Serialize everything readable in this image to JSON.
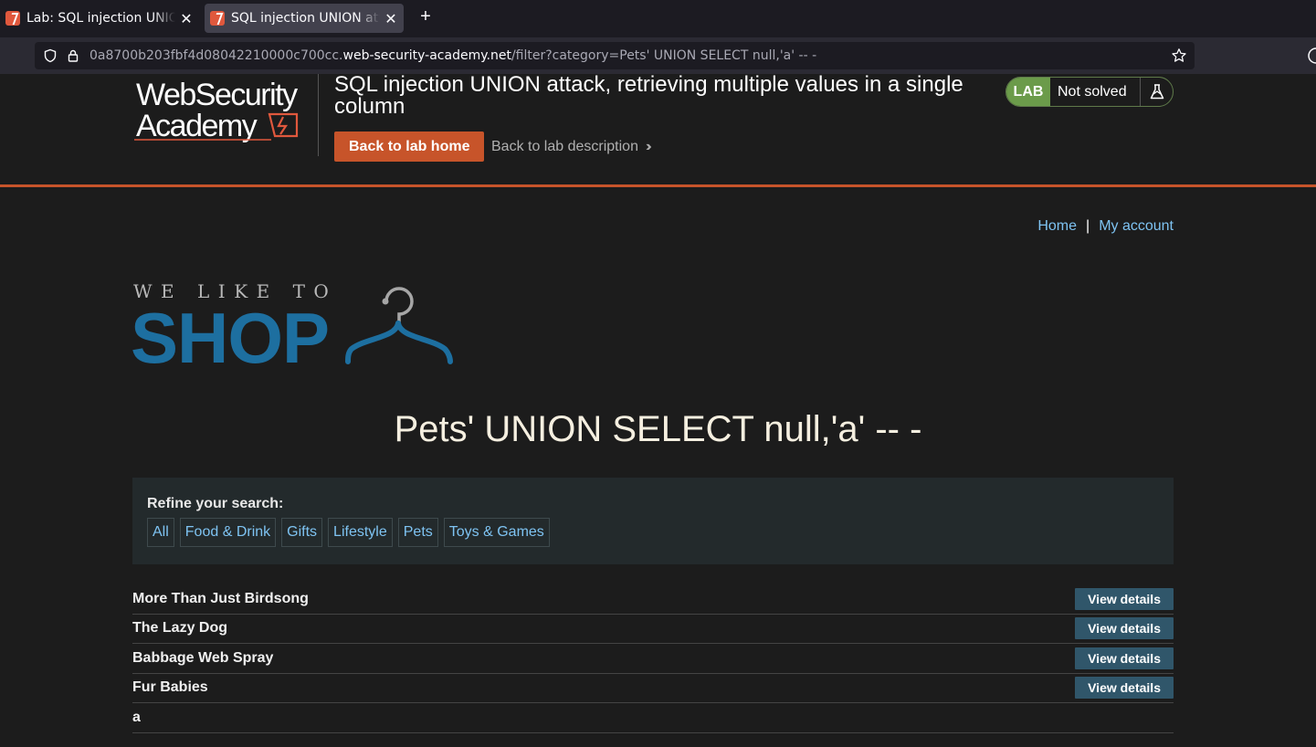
{
  "browser": {
    "tabs": [
      {
        "label": "Lab: SQL injection UNION attack, retrieving multiple values in a single column",
        "active": false
      },
      {
        "label": "SQL injection UNION attack, retrieving multiple values in a single column",
        "active": true
      }
    ],
    "url": {
      "host_prefix": "0a8700b203fbf4d08042210000c700cc.",
      "host": "web-security-academy.net",
      "path": "/filter?category=Pets' UNION SELECT null,'a' -- -"
    }
  },
  "lab_header": {
    "logo_line1": "WebSecurity",
    "logo_line2": "Academy",
    "title": "SQL injection UNION attack, retrieving multiple values in a single column",
    "back_home": "Back to lab home",
    "back_description": "Back to lab description",
    "badge": "LAB",
    "status": "Not solved"
  },
  "nav": {
    "home": "Home",
    "separator": "|",
    "account": "My account"
  },
  "shop_logo": {
    "tagline": "WE LIKE TO",
    "word": "SHOP"
  },
  "heading": "Pets' UNION SELECT null,'a' -- -",
  "filters": {
    "title": "Refine your search:",
    "items": [
      "All",
      "Food & Drink",
      "Gifts",
      "Lifestyle",
      "Pets",
      "Toys & Games"
    ]
  },
  "products": [
    {
      "name": "More Than Just Birdsong",
      "button": "View details"
    },
    {
      "name": "The Lazy Dog",
      "button": "View details"
    },
    {
      "name": "Babbage Web Spray",
      "button": "View details"
    },
    {
      "name": "Fur Babies",
      "button": "View details"
    },
    {
      "name": "a",
      "button": ""
    }
  ],
  "colors": {
    "accent": "#c7542a",
    "link": "#7ec3f2",
    "lab_badge": "#6b9b4a",
    "shop_blue": "#1d6fa0",
    "view_button": "#30566a"
  }
}
